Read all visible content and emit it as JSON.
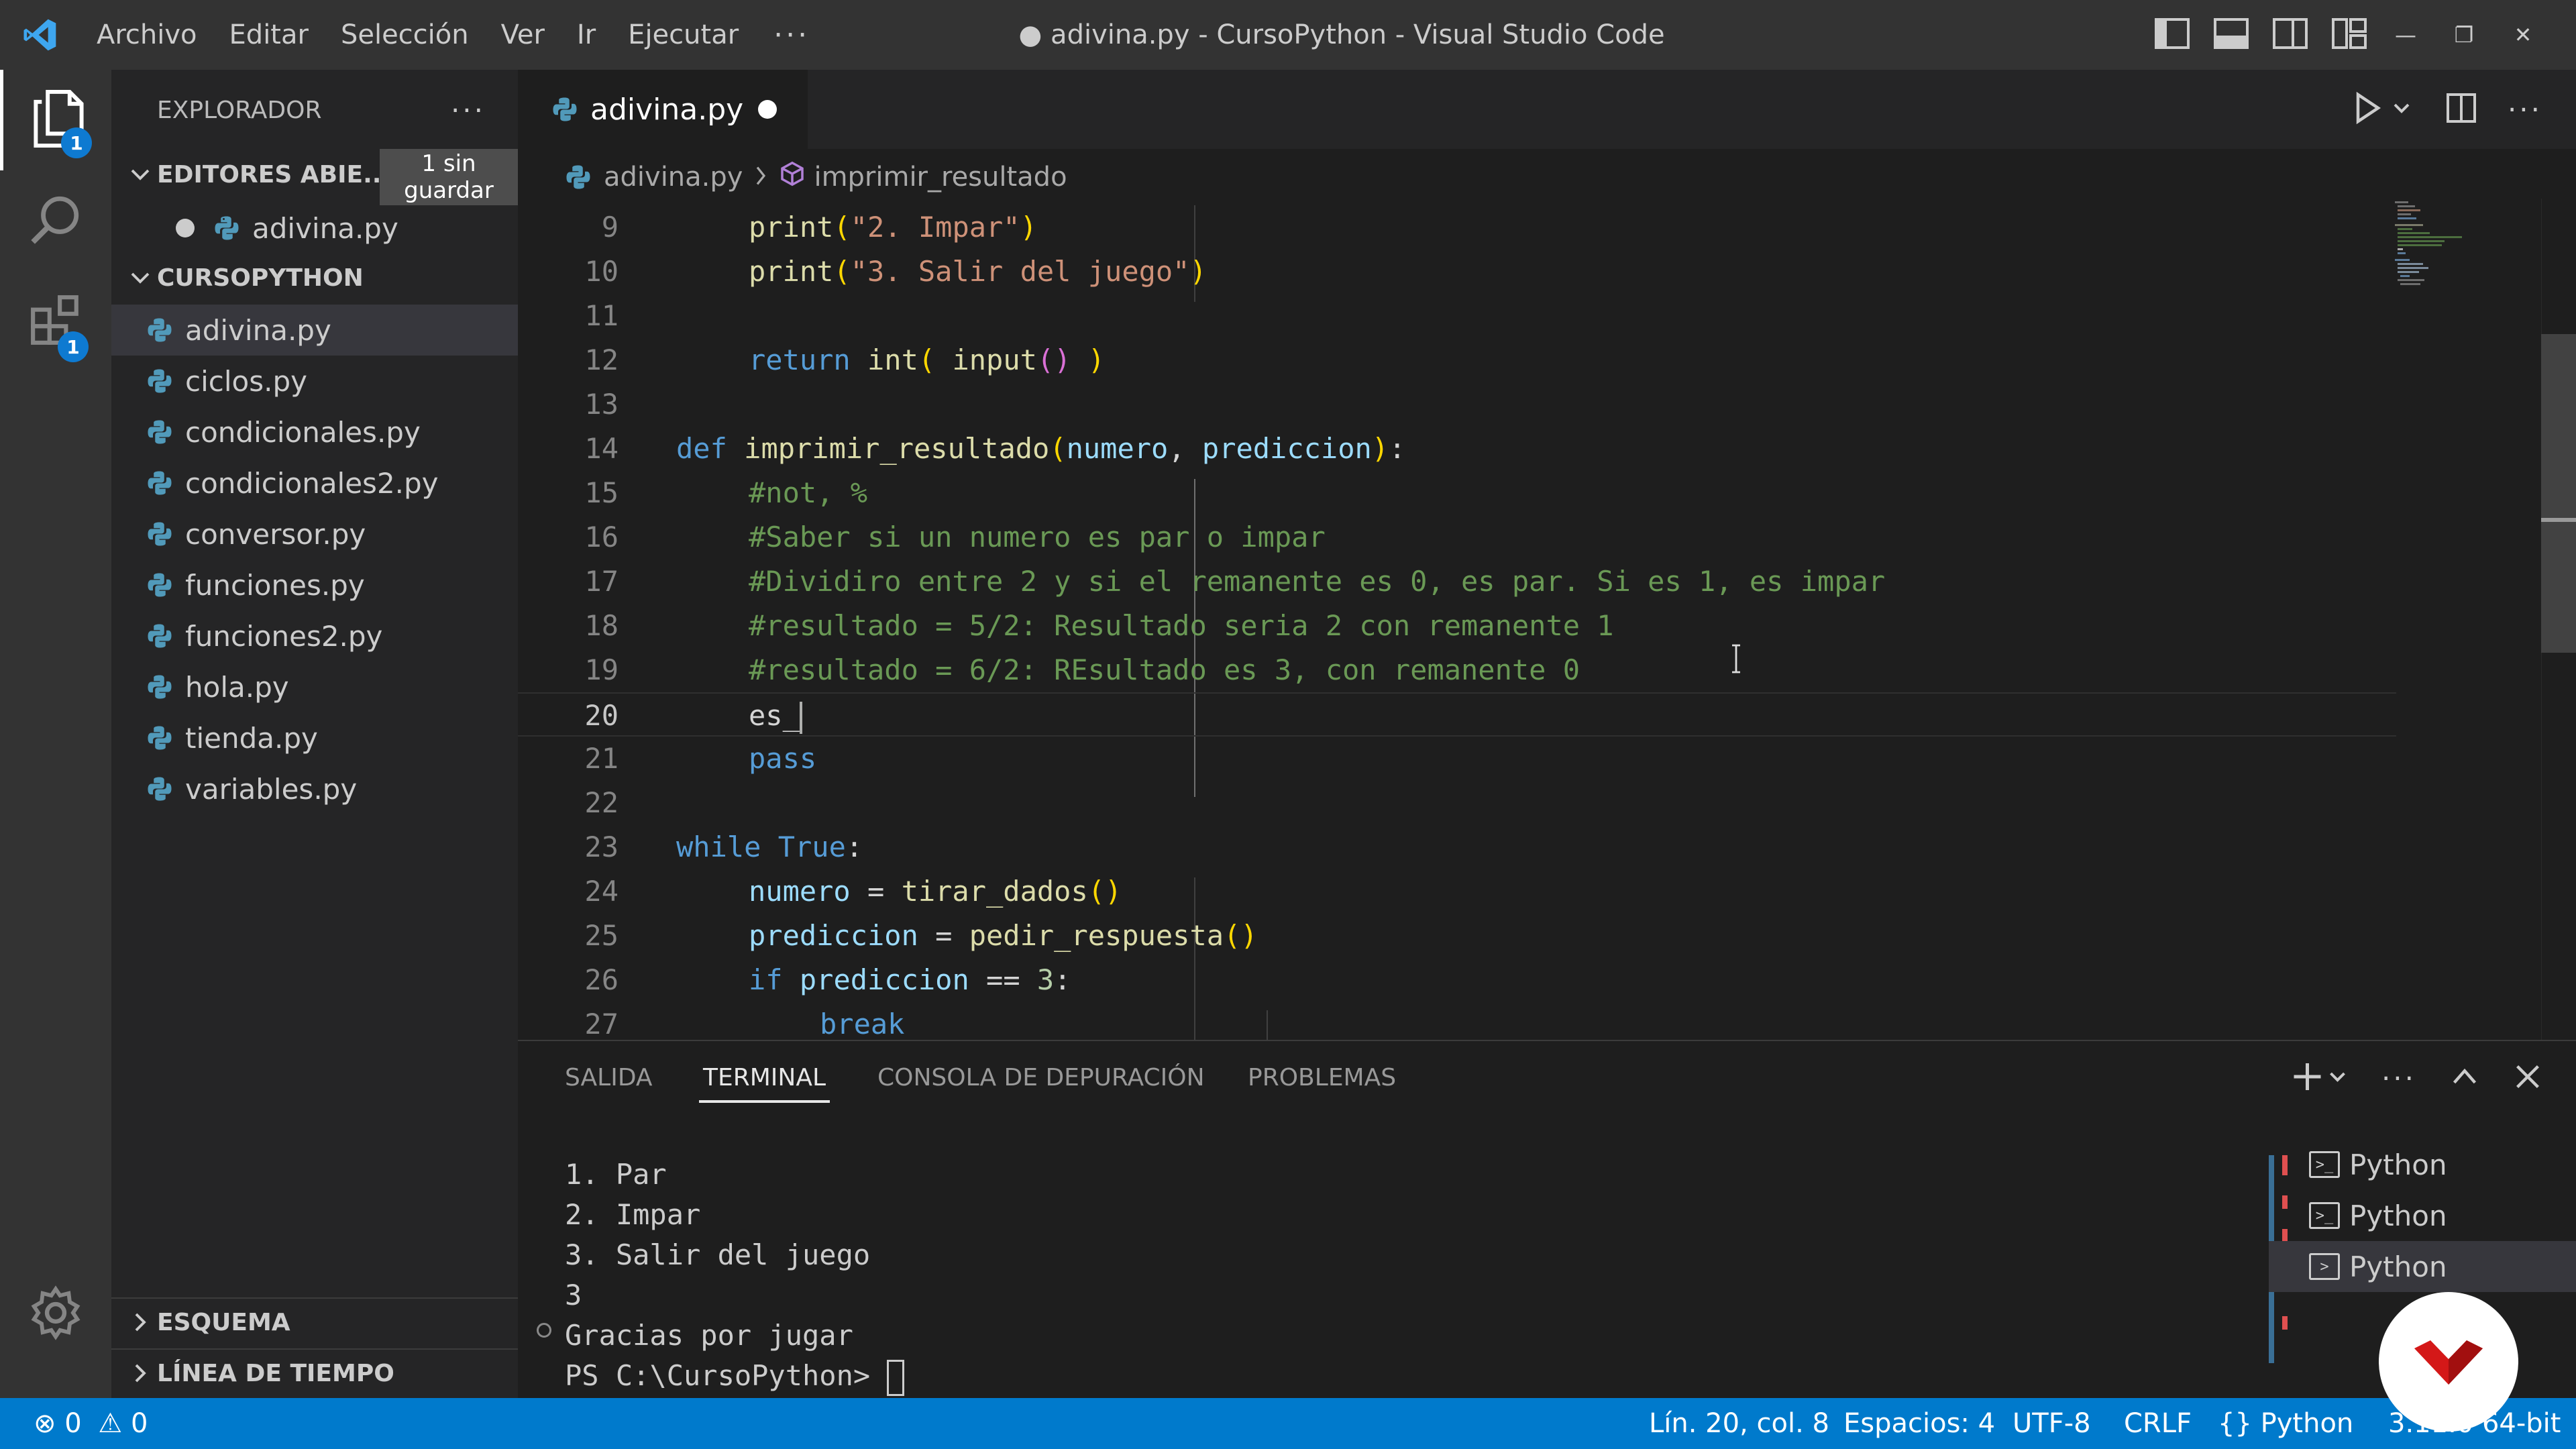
{
  "window": {
    "title": "● adivina.py - CursoPython - Visual Studio Code",
    "menu": [
      "Archivo",
      "Editar",
      "Selección",
      "Ver",
      "Ir",
      "Ejecutar"
    ],
    "more": "···"
  },
  "activity_bar": {
    "explorer_badge": "1",
    "extensions_badge": "1"
  },
  "sidebar": {
    "header": "EXPLORADOR",
    "more": "···",
    "open_editors": {
      "label": "EDITORES ABIE...",
      "unsaved_badge": "1 sin guardar",
      "files": [
        "adivina.py"
      ]
    },
    "folder": {
      "label": "CURSOPYTHON",
      "files": [
        "adivina.py",
        "ciclos.py",
        "condicionales.py",
        "condicionales2.py",
        "conversor.py",
        "funciones.py",
        "funciones2.py",
        "hola.py",
        "tienda.py",
        "variables.py"
      ],
      "selected": "adivina.py"
    },
    "outline_label": "ESQUEMA",
    "timeline_label": "LÍNEA DE TIEMPO"
  },
  "editor": {
    "tab_label": "adivina.py",
    "breadcrumb": {
      "file": "adivina.py",
      "symbol": "imprimir_resultado"
    },
    "current_line": 20,
    "lines": [
      {
        "n": "9"
      },
      {
        "n": "10"
      },
      {
        "n": "11"
      },
      {
        "n": "12"
      },
      {
        "n": "13"
      },
      {
        "n": "14"
      },
      {
        "n": "15"
      },
      {
        "n": "16"
      },
      {
        "n": "17"
      },
      {
        "n": "18"
      },
      {
        "n": "19"
      },
      {
        "n": "20"
      },
      {
        "n": "21"
      },
      {
        "n": "22"
      },
      {
        "n": "23"
      },
      {
        "n": "24"
      },
      {
        "n": "25"
      },
      {
        "n": "26"
      },
      {
        "n": "27"
      }
    ],
    "code": {
      "l9_fn": "print",
      "l9_str": "\"2. Impar\"",
      "l10_fn": "print",
      "l10_str": "\"3. Salir del juego\"",
      "l12_kw": "return",
      "l12_fn1": "int",
      "l12_fn2": "input",
      "l14_kw": "def",
      "l14_fn": "imprimir_resultado",
      "l14_p1": "numero",
      "l14_p2": "prediccion",
      "l15": "#not, %",
      "l16": "#Saber si un numero es par o impar",
      "l17": "#Dividiro entre 2 y si el remanente es 0, es par. Si es 1, es impar",
      "l18": "#resultado = 5/2: Resultado seria 2 con remanente 1",
      "l19": "#resultado = 6/2: REsultado es 3, con remanente 0",
      "l20": "es_",
      "l21": "pass",
      "l23_kw": "while",
      "l23_val": "True",
      "l24_var": "numero",
      "l24_fn": "tirar_dados",
      "l25_var": "prediccion",
      "l25_fn": "pedir_respuesta",
      "l26_kw": "if",
      "l26_var": "prediccion",
      "l26_num": "3",
      "l27": "break"
    }
  },
  "panel": {
    "tabs": [
      "SALIDA",
      "TERMINAL",
      "CONSOLA DE DEPURACIÓN",
      "PROBLEMAS"
    ],
    "active_tab": "TERMINAL",
    "terminal_lines": [
      "1. Par",
      "2. Impar",
      "3. Salir del juego",
      "3",
      "Gracias por jugar",
      "PS C:\\CursoPython> "
    ],
    "terminals": [
      "Python",
      "Python",
      "Python"
    ]
  },
  "status_bar": {
    "errors": "0",
    "warnings": "0",
    "position": "Lín. 20, col. 8",
    "spaces": "Espacios: 4",
    "encoding": "UTF-8",
    "eol": "CRLF",
    "language": "Python",
    "interpreter": "3.11.0 64-bit"
  },
  "colors": {
    "accent": "#007acc",
    "keyword": "#569cd6",
    "function": "#dcdcaa",
    "string": "#ce9178",
    "comment": "#6a9955",
    "python_icon": "#519aba"
  }
}
